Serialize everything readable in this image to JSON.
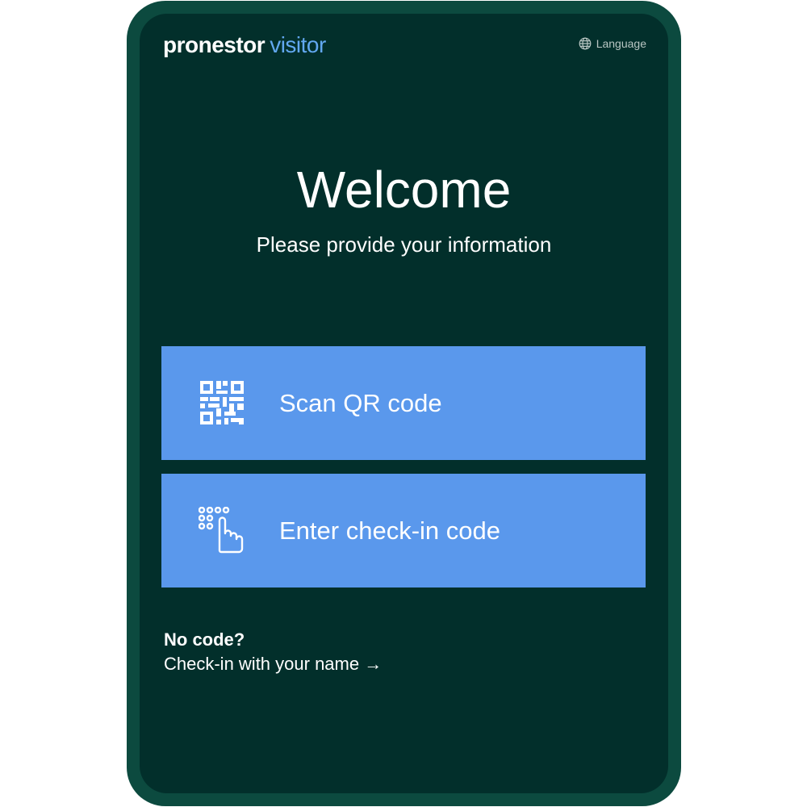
{
  "header": {
    "logo_brand": "pronestor",
    "logo_product": "visitor",
    "language_label": "Language",
    "language_icon": "globe-icon"
  },
  "main": {
    "title": "Welcome",
    "subtitle": "Please provide your information",
    "actions": [
      {
        "label": "Scan QR code",
        "icon": "qr-code-icon"
      },
      {
        "label": "Enter check-in code",
        "icon": "keypad-tap-icon"
      }
    ],
    "no_code_heading": "No code?",
    "name_checkin_link": "Check-in with your name →"
  },
  "colors": {
    "device_frame": "#0c4a3f",
    "background": "#022f2b",
    "button": "#5a98ec",
    "logo_accent": "#62a8f0",
    "text": "#ffffff"
  }
}
